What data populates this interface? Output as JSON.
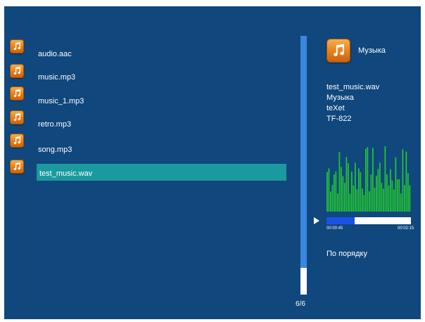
{
  "file_list": {
    "items": [
      {
        "name": "audio.aac",
        "icon": "music-note-icon"
      },
      {
        "name": "music.mp3",
        "icon": "music-note-icon"
      },
      {
        "name": "music_1.mp3",
        "icon": "music-note-icon"
      },
      {
        "name": "retro.mp3",
        "icon": "music-note-icon"
      },
      {
        "name": "song.mp3",
        "icon": "music-note-icon"
      },
      {
        "name": "test_music.wav",
        "icon": "music-note-icon"
      }
    ],
    "selected_index": 5,
    "page_indicator": "6/6"
  },
  "now_playing": {
    "category": "Музыка",
    "info": [
      "test_music.wav",
      "Музыка",
      "teXet",
      "TF-822"
    ],
    "elapsed": "00:00:45",
    "total": "00:02:15",
    "progress": 0.33,
    "repeat_mode": "По порядку"
  },
  "colors": {
    "background": "#10477c",
    "selection": "#1a9a9e",
    "scrollbar": "#3a87e0",
    "spectrum": "#22c532",
    "progress": "#1b52e6"
  }
}
